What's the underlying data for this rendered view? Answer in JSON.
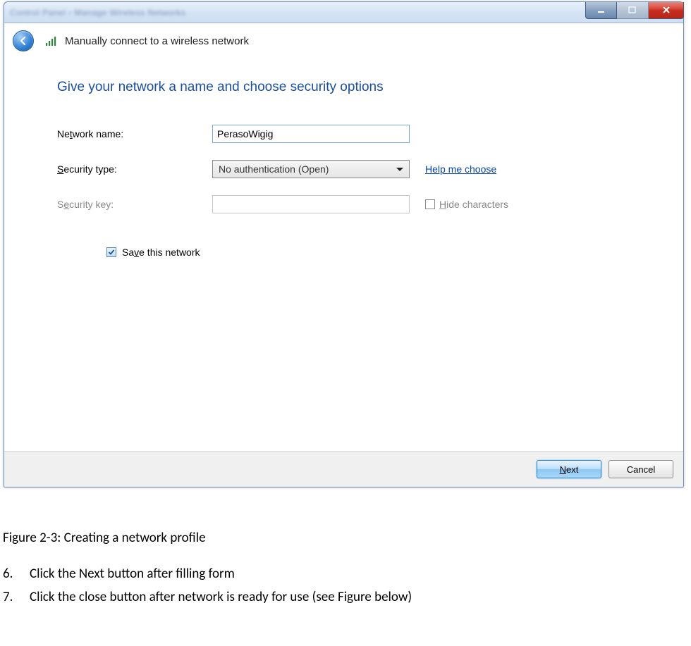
{
  "titlebar": {
    "breadcrumb": "Control Panel  ›  Manage Wireless Networks"
  },
  "window_controls": {
    "minimize_name": "minimize",
    "maximize_name": "maximize",
    "close_name": "close"
  },
  "header": {
    "wizard_title": "Manually connect to a wireless network"
  },
  "content": {
    "heading": "Give your network a name and choose security options",
    "rows": {
      "network_name_label": "Network name:",
      "network_name_value": "PerasoWigig",
      "security_type_label": "Security type:",
      "security_type_value": "No authentication (Open)",
      "help_link": "Help me choose",
      "security_key_label": "Security key:",
      "security_key_value": "",
      "hide_chars_label": "Hide characters",
      "save_label": "Save this network"
    }
  },
  "buttons": {
    "next": "Next",
    "cancel": "Cancel"
  },
  "doc": {
    "caption": "Figure 2-3: Creating a network profile",
    "steps": [
      {
        "n": "6.",
        "text": "Click the Next button after filling form"
      },
      {
        "n": "7.",
        "text": "Click the close button after network is ready for use (see Figure below)"
      }
    ]
  }
}
